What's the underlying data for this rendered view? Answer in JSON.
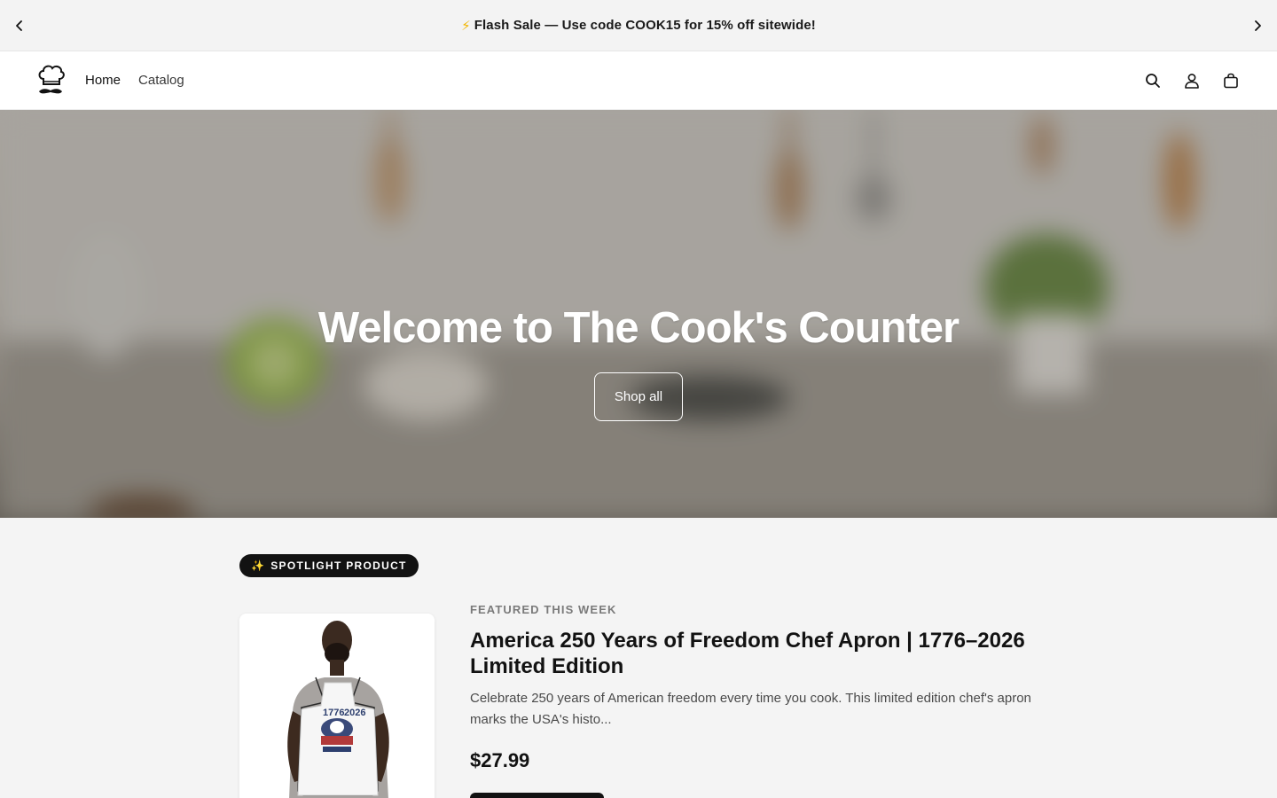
{
  "announcement": {
    "prev_icon": "chevron-left-icon",
    "next_icon": "chevron-right-icon",
    "emoji": "⚡",
    "text": "Flash Sale — Use code COOK15 for 15% off sitewide!"
  },
  "header": {
    "logo_icon": "chef-hat-mustache-logo",
    "nav": [
      {
        "label": "Home"
      },
      {
        "label": "Catalog"
      }
    ],
    "icons": [
      "search-icon",
      "account-icon",
      "cart-icon"
    ]
  },
  "hero": {
    "title": "Welcome to The Cook's Counter",
    "button_label": "Shop all"
  },
  "spotlight": {
    "badge_emoji": "✨",
    "badge_label": "SPOTLIGHT PRODUCT",
    "eyebrow": "FEATURED THIS WEEK",
    "product_title": "America 250 Years of Freedom Chef Apron | 1776–2026 Limited Edition",
    "description": "Celebrate 250 years of American freedom every time you cook. This limited edition chef's apron marks the USA's histo...",
    "price": "$27.99"
  },
  "colors": {
    "accent_dark": "#121212",
    "background": "#f4f4f4",
    "bolt": "#f2b600"
  }
}
